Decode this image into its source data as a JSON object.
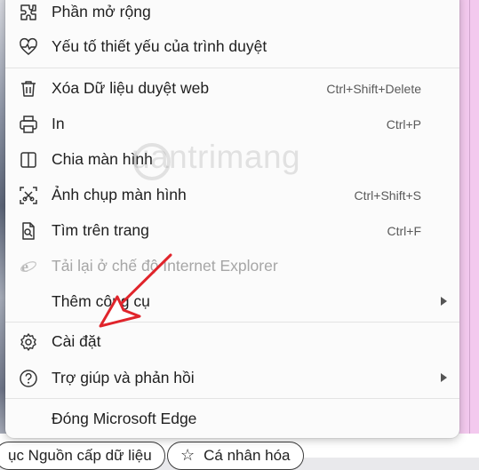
{
  "menu": {
    "items": [
      {
        "label": "Phần mở rộng",
        "shortcut": "",
        "icon": "puzzle-icon"
      },
      {
        "label": "Yếu tố thiết yếu của trình duyệt",
        "shortcut": "",
        "icon": "heart-pulse-icon"
      },
      {
        "label": "Xóa Dữ liệu duyệt web",
        "shortcut": "Ctrl+Shift+Delete",
        "icon": "trash-icon"
      },
      {
        "label": "In",
        "shortcut": "Ctrl+P",
        "icon": "printer-icon"
      },
      {
        "label": "Chia màn hình",
        "shortcut": "",
        "icon": "split-screen-icon"
      },
      {
        "label": "Ảnh chụp màn hình",
        "shortcut": "Ctrl+Shift+S",
        "icon": "screenshot-icon"
      },
      {
        "label": "Tìm trên trang",
        "shortcut": "Ctrl+F",
        "icon": "find-page-icon"
      },
      {
        "label": "Tải lại ở chế độ Internet Explorer",
        "shortcut": "",
        "icon": "ie-icon",
        "disabled": true
      },
      {
        "label": "Thêm công cụ",
        "shortcut": "",
        "icon": "",
        "submenu": true
      },
      {
        "label": "Cài đặt",
        "shortcut": "",
        "icon": "gear-icon"
      },
      {
        "label": "Trợ giúp và phản hồi",
        "shortcut": "",
        "icon": "help-icon",
        "submenu": true
      },
      {
        "label": "Đóng Microsoft Edge",
        "shortcut": "",
        "icon": ""
      }
    ]
  },
  "bottom": {
    "pill1": "ục Nguồn cấp dữ liệu",
    "pill2": "Cá nhân hóa"
  },
  "watermark": "uantrimang",
  "colors": {
    "arrow": "#e0242b",
    "menu_bg": "#fbfbfb",
    "text": "#1f1f1f",
    "muted": "#a6a6a6"
  }
}
